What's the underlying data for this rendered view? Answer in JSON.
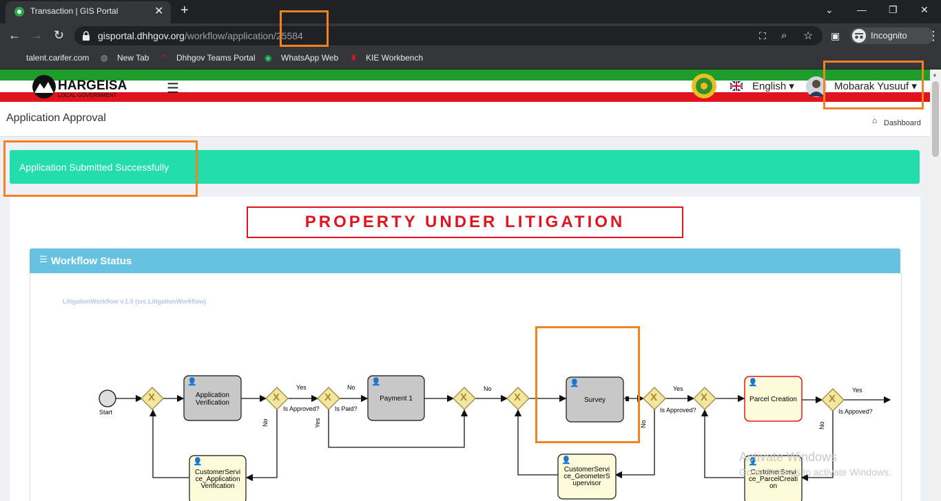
{
  "browser": {
    "tab_title": "Transaction | GIS Portal",
    "url_host": "gisportal.dhhgov.org",
    "url_path": "/workflow/application/25584",
    "incognito_label": "Incognito",
    "bookmarks": [
      "talent.carifer.com",
      "New Tab",
      "Dhhgov Teams Portal",
      "WhatsApp Web",
      "KIE Workbench"
    ]
  },
  "header": {
    "logo_text": "HARGEISA",
    "logo_sub": "LOCAL GOVERNMENT",
    "language": "English",
    "user_name": "Mobarak Yusuuf"
  },
  "page": {
    "title": "Application Approval",
    "breadcrumb": "Dashboard",
    "alert": "Application Submitted Successfully",
    "banner": "PROPERTY UNDER LITIGATION",
    "panel_title": "Workflow Status",
    "workflow_label": "LitigationWorkflow v.1.0 (src.LitigationWorkflow)"
  },
  "workflow": {
    "start": "Start",
    "tasks": {
      "app_verification": "Application Verification",
      "payment": "Payment 1",
      "survey": "Survey",
      "parcel_creation": "Parcel Creation",
      "cs_app_verif_1": "CustomerServi",
      "cs_app_verif_2": "ce_Application",
      "cs_app_verif_3": "Verification",
      "cs_geo_1": "CustomerServi",
      "cs_geo_2": "ce_GeometerS",
      "cs_geo_3": "upervisor",
      "cs_parcel_1": "CustomerServi",
      "cs_parcel_2": "ce_ParcelCreati",
      "cs_parcel_3": "on"
    },
    "labels": {
      "yes": "Yes",
      "no": "No",
      "is_approved": "Is Approved?",
      "is_paid": "Is Paid?",
      "is_appoved": "Is Appoved?",
      "gateway": "X"
    }
  },
  "watermark": {
    "line1": "Activate Windows",
    "line2": "Go to Settings to activate Windows."
  }
}
